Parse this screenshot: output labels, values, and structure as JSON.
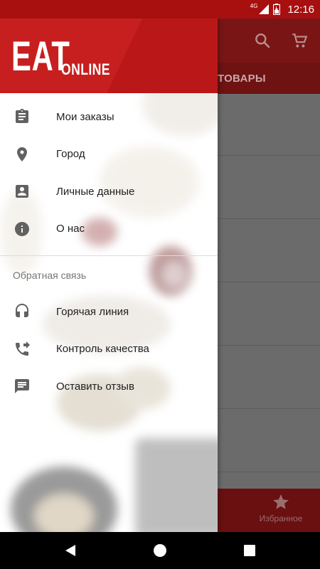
{
  "status_bar": {
    "network": "4G",
    "time": "12:16",
    "color": "#a80f0f"
  },
  "background_app": {
    "tab_label": "ТОВАРЫ",
    "bottom_nav": {
      "favorites_label": "Избранное"
    },
    "icons": [
      "search-icon",
      "cart-icon",
      "star-icon"
    ]
  },
  "drawer": {
    "logo": {
      "eat": "EAT",
      "online": "ONLINE"
    },
    "header_color": "#c41e1e",
    "items": [
      {
        "label": "Мои заказы",
        "icon": "clipboard-icon"
      },
      {
        "label": "Город",
        "icon": "location-pin-icon"
      },
      {
        "label": "Личные данные",
        "icon": "account-box-icon"
      },
      {
        "label": "О нас",
        "icon": "info-icon"
      }
    ],
    "feedback_section": {
      "title": "Обратная связь",
      "items": [
        {
          "label": "Горячая линия",
          "icon": "headset-icon"
        },
        {
          "label": "Контроль качества",
          "icon": "phone-forwarded-icon"
        },
        {
          "label": "Оставить отзыв",
          "icon": "feedback-icon"
        }
      ]
    }
  },
  "nav_bar": {
    "icons": [
      "back-icon",
      "home-icon",
      "recents-icon"
    ]
  }
}
